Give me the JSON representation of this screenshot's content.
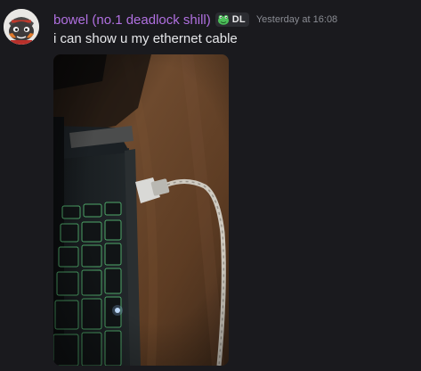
{
  "message": {
    "author": "bowel (no.1 deadlock shill)",
    "tag": {
      "icon": "frog-icon",
      "text": "DL"
    },
    "timestamp": "Yesterday at 16:08",
    "content": "i can show u my ethernet cable"
  },
  "colors": {
    "background": "#1a1a1e",
    "username": "#b070e0",
    "timestamp": "#8a8c93",
    "text": "#e6e7ea",
    "tag_bg": "#2b2c31"
  }
}
